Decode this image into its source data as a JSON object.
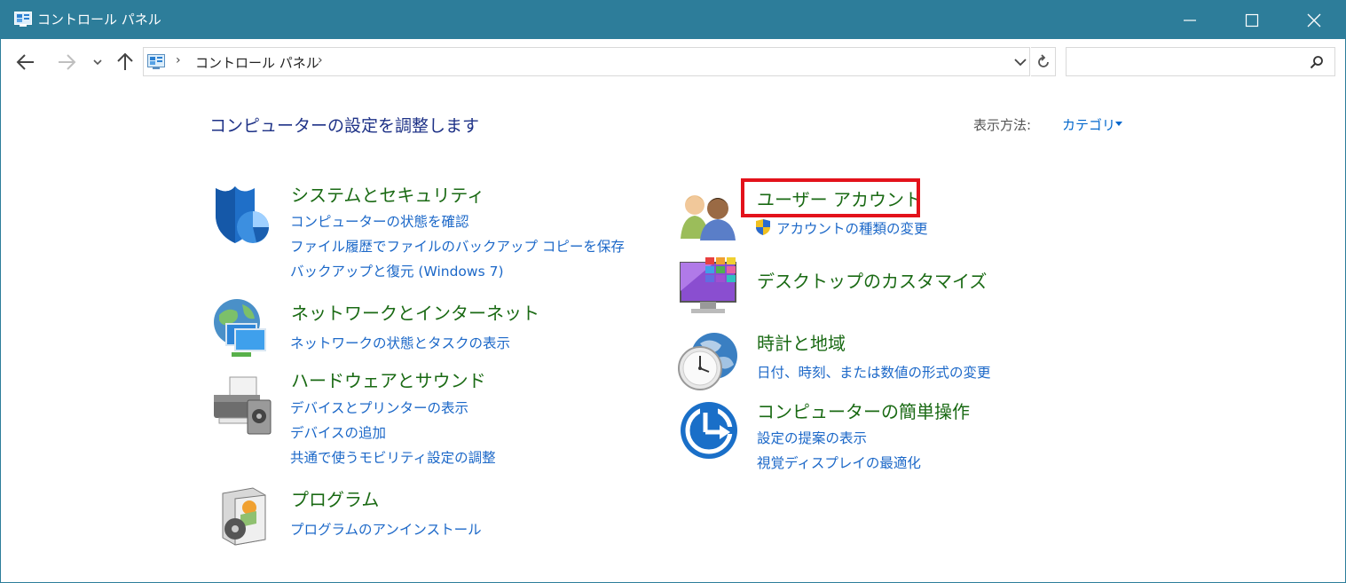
{
  "window": {
    "title": "コントロール パネル"
  },
  "navbar": {
    "breadcrumb": "コントロール パネル",
    "separator": "›",
    "search_placeholder": ""
  },
  "content": {
    "heading": "コンピューターの設定を調整します",
    "view_by_label": "表示方法:",
    "view_by_value": "カテゴリ"
  },
  "categories": {
    "system": {
      "title": "システムとセキュリティ",
      "links": [
        "コンピューターの状態を確認",
        "ファイル履歴でファイルのバックアップ コピーを保存",
        "バックアップと復元 (Windows 7)"
      ]
    },
    "network": {
      "title": "ネットワークとインターネット",
      "links": [
        "ネットワークの状態とタスクの表示"
      ]
    },
    "hardware": {
      "title": "ハードウェアとサウンド",
      "links": [
        "デバイスとプリンターの表示",
        "デバイスの追加",
        "共通で使うモビリティ設定の調整"
      ]
    },
    "programs": {
      "title": "プログラム",
      "links": [
        "プログラムのアンインストール"
      ]
    },
    "users": {
      "title": "ユーザー アカウント",
      "links": [
        "アカウントの種類の変更"
      ]
    },
    "appearance": {
      "title": "デスクトップのカスタマイズ",
      "links": []
    },
    "clock": {
      "title": "時計と地域",
      "links": [
        "日付、時刻、または数値の形式の変更"
      ]
    },
    "ease": {
      "title": "コンピューターの簡単操作",
      "links": [
        "設定の提案の表示",
        "視覚ディスプレイの最適化"
      ]
    }
  },
  "colors": {
    "titlebar": "#2d7d9a",
    "category_title": "#1a6a14",
    "link": "#1c68c8",
    "heading": "#1e3287",
    "highlight": "#e3121b"
  },
  "icons": {
    "system": "shield-icon",
    "network": "network-globe-icon",
    "hardware": "printer-icon",
    "programs": "program-box-icon",
    "users": "users-icon",
    "appearance": "desktop-monitor-icon",
    "clock": "clock-globe-icon",
    "ease": "ease-of-access-icon"
  }
}
